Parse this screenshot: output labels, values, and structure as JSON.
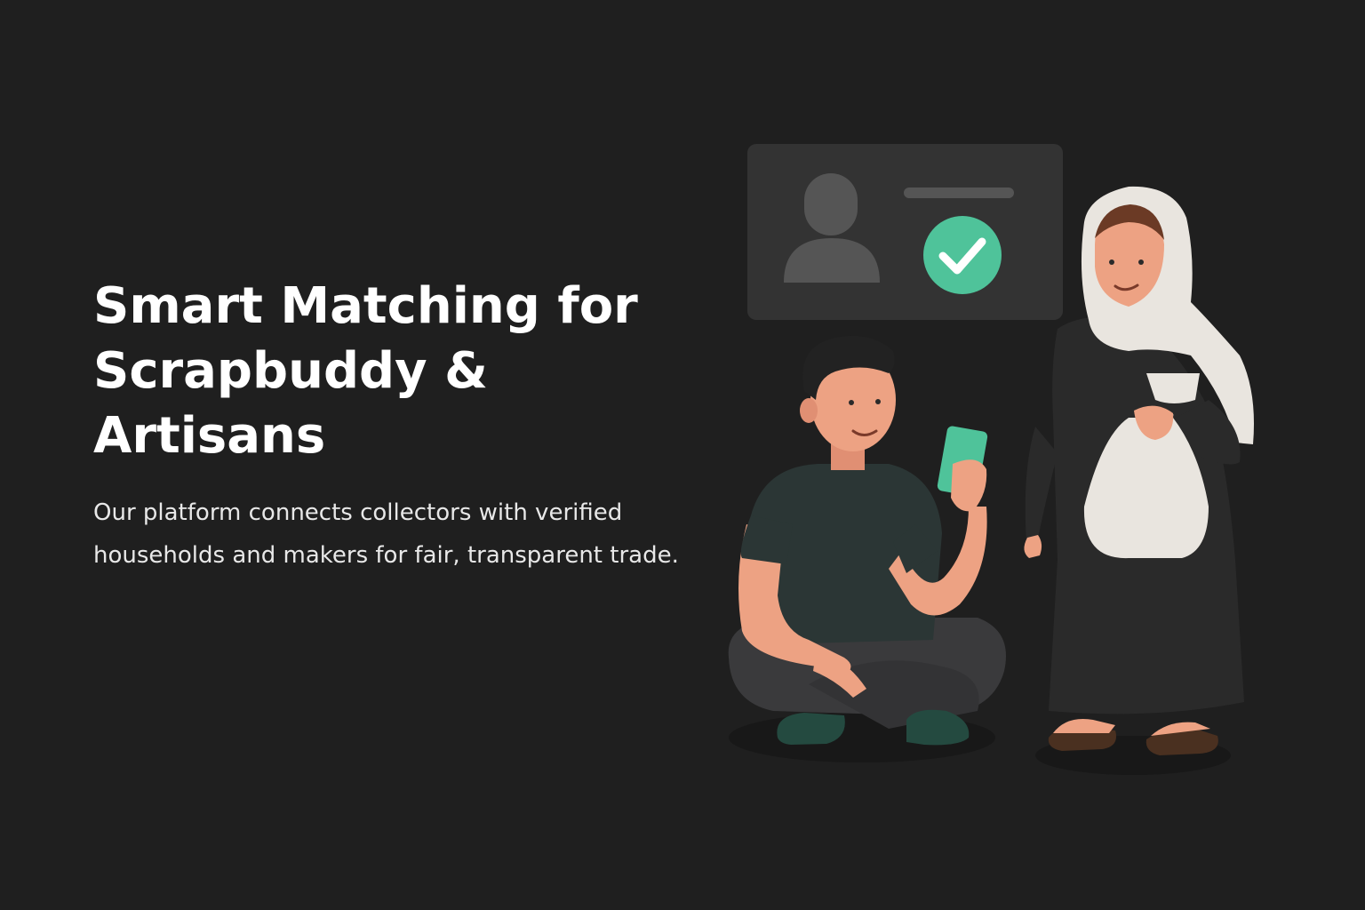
{
  "hero": {
    "headline_lines": [
      "Smart Matching for",
      "Scrapbuddy &",
      "Artisans"
    ],
    "description": "Our platform connects collectors with verified households and makers for fair, transparent trade."
  },
  "illustration": {
    "profile_card_icons": [
      "user-avatar-icon",
      "check-icon"
    ],
    "figures": [
      "collector-figure",
      "household-woman-figure"
    ],
    "colors": {
      "background": "#1f1f1f",
      "card": "#333333",
      "accent_green": "#4fc39a",
      "shirt": "#2b3635",
      "robe": "#2a2a2a",
      "skin": "#eda283",
      "scarf": "#e9e5df"
    }
  }
}
